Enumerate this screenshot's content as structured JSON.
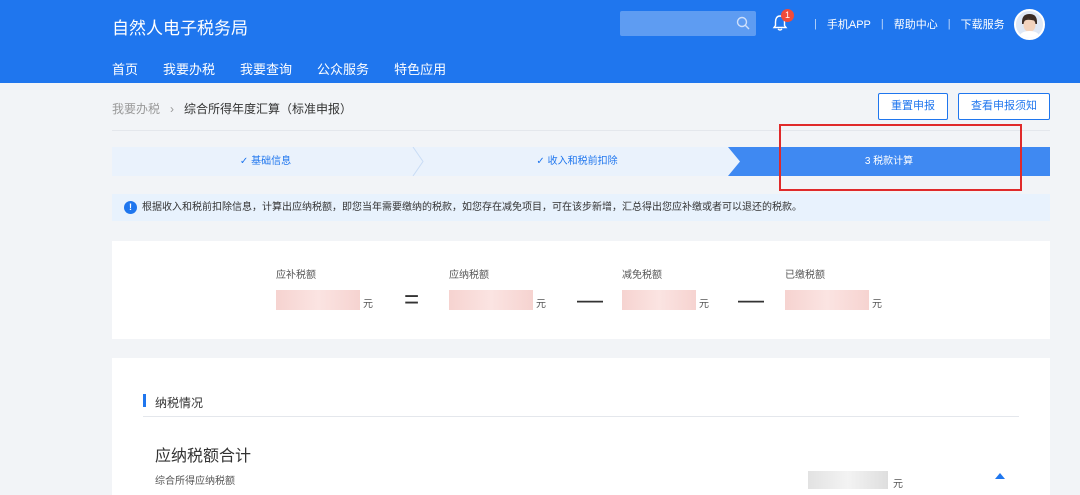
{
  "header": {
    "brand": "自然人电子税务局",
    "nav": [
      "首页",
      "我要办税",
      "我要查询",
      "公众服务",
      "特色应用"
    ],
    "search": {
      "placeholder": ""
    },
    "notification_count": "1",
    "links": [
      "手机APP",
      "帮助中心",
      "下载服务"
    ]
  },
  "breadcrumb": {
    "parent": "我要办税",
    "current": "综合所得年度汇算（标准申报）"
  },
  "actions": {
    "reset": "重置申报",
    "notice": "查看申报须知"
  },
  "steps": [
    {
      "label": "✓ 基础信息",
      "state": "done"
    },
    {
      "label": "✓ 收入和税前扣除",
      "state": "done"
    },
    {
      "label": "3 税款计算",
      "state": "active"
    }
  ],
  "tip": "根据收入和税前扣除信息，计算出应纳税额，即您当年需要缴纳的税款，如您存在减免项目，可在该步新增，汇总得出您应补缴或者可以退还的税款。",
  "formula": {
    "items": [
      {
        "label": "应补税额",
        "unit": "元"
      },
      {
        "label": "应纳税额",
        "unit": "元"
      },
      {
        "label": "减免税额",
        "unit": "元"
      },
      {
        "label": "已缴税额",
        "unit": "元"
      }
    ],
    "ops": [
      "=",
      "—",
      "—"
    ]
  },
  "panel": {
    "section_title": "纳税情况",
    "summary_title": "应纳税额合计",
    "summary_sub": "综合所得应纳税额",
    "summary_unit": "元"
  },
  "colors": {
    "primary": "#1f76ee",
    "highlight": "#e02a2a"
  }
}
